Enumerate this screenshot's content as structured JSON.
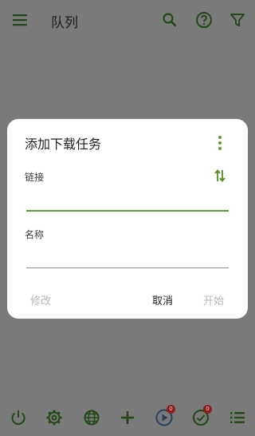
{
  "appbar": {
    "title": "队列",
    "menu_icon": "hamburger-menu-icon",
    "actions": [
      "search-icon",
      "help-icon",
      "filter-icon"
    ]
  },
  "dialog": {
    "title": "添加下载任务",
    "link": {
      "label": "链接",
      "value": "",
      "placeholder": ""
    },
    "name": {
      "label": "名称",
      "value": "",
      "placeholder": ""
    },
    "buttons": {
      "edit": "修改",
      "cancel": "取消",
      "start": "开始"
    }
  },
  "bottombar": {
    "icons": [
      "power-icon",
      "settings-icon",
      "globe-icon",
      "add-icon",
      "play-icon",
      "check-circle-icon",
      "list-icon"
    ],
    "badges": {
      "play": "0",
      "done": "0"
    }
  },
  "colors": {
    "accent": "#5f9b2f",
    "scrim": "#7a7a7a",
    "dialog_bg": "#ffffff",
    "disabled_text": "#b7b7b7",
    "badge": "#8b1e1e",
    "play_accent": "#27405c"
  }
}
